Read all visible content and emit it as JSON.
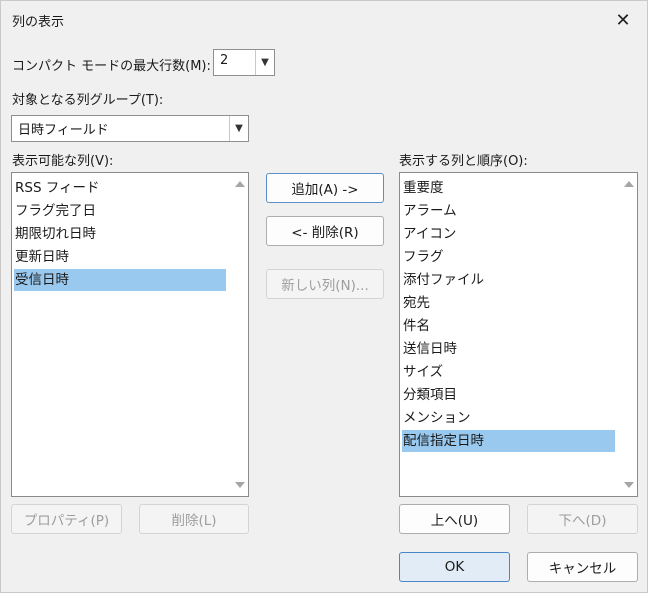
{
  "window": {
    "title": "列の表示"
  },
  "compact": {
    "label": "コンパクト モードの最大行数(M):",
    "value": "2"
  },
  "group": {
    "label": "対象となる列グループ(T):",
    "value": "日時フィールド"
  },
  "available": {
    "label": "表示可能な列(V):",
    "items": [
      "RSS フィード",
      "フラグ完了日",
      "期限切れ日時",
      "更新日時",
      "受信日時"
    ],
    "selected_index": 4
  },
  "shown": {
    "label": "表示する列と順序(O):",
    "items": [
      "重要度",
      "アラーム",
      "アイコン",
      "フラグ",
      "添付ファイル",
      "宛先",
      "件名",
      "送信日時",
      "サイズ",
      "分類項目",
      "メンション",
      "配信指定日時"
    ],
    "selected_index": 11
  },
  "buttons": {
    "add": "追加(A) ->",
    "remove": "<- 削除(R)",
    "new_column": "新しい列(N)...",
    "properties": "プロパティ(P)",
    "delete": "削除(L)",
    "move_up": "上へ(U)",
    "move_down": "下へ(D)",
    "ok": "OK",
    "cancel": "キャンセル"
  }
}
